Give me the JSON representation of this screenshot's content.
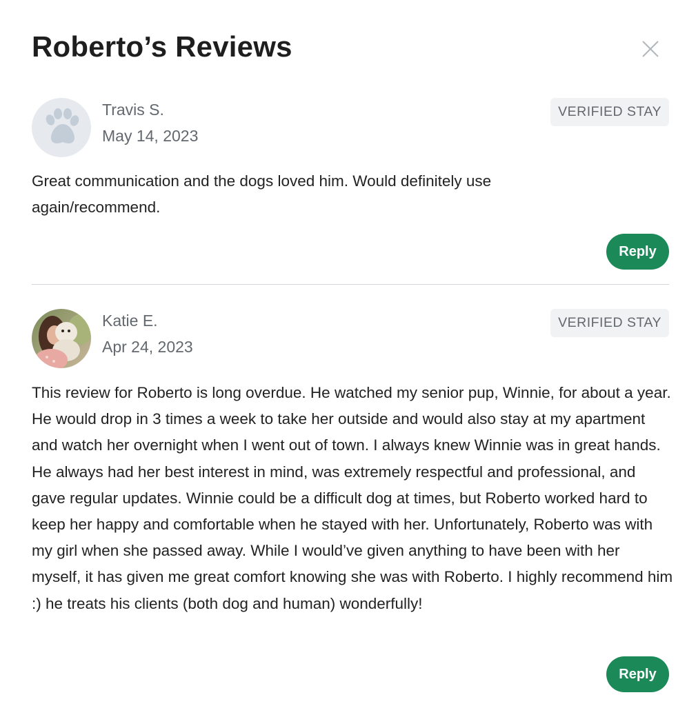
{
  "modal": {
    "title": "Roberto’s Reviews"
  },
  "reviews": [
    {
      "name": "Travis S.",
      "date": "May 14, 2023",
      "badge": "VERIFIED STAY",
      "text": "Great communication and the dogs loved him. Would definitely use again/recommend.",
      "reply_label": "Reply",
      "avatar": "paw-icon"
    },
    {
      "name": "Katie E.",
      "date": "Apr 24, 2023",
      "badge": "VERIFIED STAY",
      "text": "This review for Roberto is long overdue. He watched my senior pup, Winnie, for about a year. He would drop in 3 times a week to take her outside and would also stay at my apartment and watch her overnight when I went out of town. I always knew Winnie was in great hands. He always had her best interest in mind, was extremely respectful and professional, and gave regular updates. Winnie could be a difficult dog at times, but Roberto worked hard to keep her happy and comfortable when he stayed with her. Unfortunately, Roberto was with my girl when she passed away. While I would’ve given anything to have been with her myself, it has given me great comfort knowing she was with Roberto. I highly recommend him :) he treats his clients (both dog and human) wonderfully!",
      "reply_label": "Reply",
      "avatar": "user-photo"
    }
  ],
  "colors": {
    "accent": "#1b8a58",
    "badge_bg": "#f1f2f4",
    "muted_text": "#62686e"
  }
}
